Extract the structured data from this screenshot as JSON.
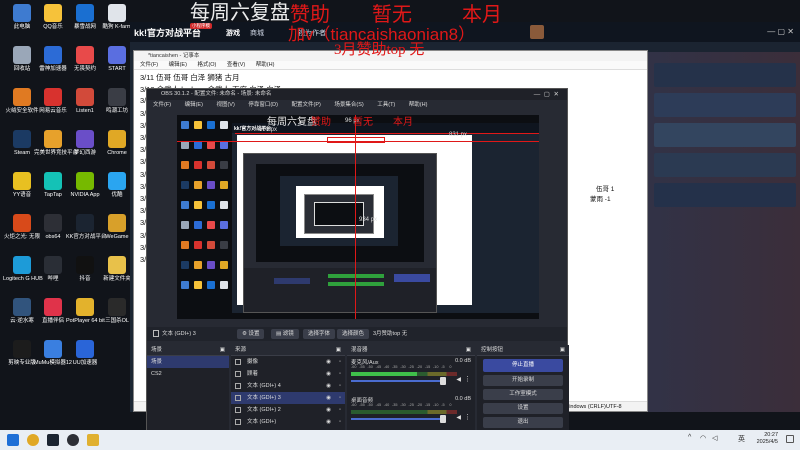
{
  "desktop": {
    "icons": [
      {
        "label": "此电脑",
        "color": "#3e7bd0",
        "icon": "computer-icon"
      },
      {
        "label": "QQ音乐",
        "color": "#f6c23a",
        "icon": "qq-music-icon"
      },
      {
        "label": "暴雪战网",
        "color": "#1a6fd1",
        "icon": "battlenet-icon"
      },
      {
        "label": "酷狗 K-farm",
        "color": "#e0e4ea",
        "icon": "app-icon"
      },
      {
        "label": "回收站",
        "color": "#9aa7b8",
        "icon": "recycle-bin-icon"
      },
      {
        "label": "雷神加速器",
        "color": "#2c6bd6",
        "icon": "accelerator-icon"
      },
      {
        "label": "无畏契约",
        "color": "#e84a4a",
        "icon": "valorant-icon"
      },
      {
        "label": "START",
        "color": "#5a6ee0",
        "icon": "start-icon"
      },
      {
        "label": "火绒安全软件",
        "color": "#e07a22",
        "icon": "huorong-icon"
      },
      {
        "label": "网易云音乐",
        "color": "#d8322e",
        "icon": "netease-music-icon"
      },
      {
        "label": "Listen1",
        "color": "#d24a3a",
        "icon": "listen1-icon"
      },
      {
        "label": "鸣潮工坊",
        "color": "#3a3d45",
        "icon": "app-icon"
      },
      {
        "label": "Steam",
        "color": "#1b3a63",
        "icon": "steam-icon"
      },
      {
        "label": "完美世界竞技平台",
        "color": "#e7a12b",
        "icon": "perfect-world-icon"
      },
      {
        "label": "梦幻西游",
        "color": "#6a4ec8",
        "icon": "game-icon"
      },
      {
        "label": "Chrome",
        "color": "#e0a825",
        "icon": "chrome-icon"
      },
      {
        "label": "YY语音",
        "color": "#e8c021",
        "icon": "yy-icon"
      },
      {
        "label": "TapTap",
        "color": "#14c2b6",
        "icon": "taptap-icon"
      },
      {
        "label": "NVIDIA App",
        "color": "#76b900",
        "icon": "nvidia-icon"
      },
      {
        "label": "优酷",
        "color": "#2aa5f0",
        "icon": "youku-icon"
      },
      {
        "label": "火炬之光: 无限",
        "color": "#d84a1a",
        "icon": "game-icon"
      },
      {
        "label": "obs64",
        "color": "#2d2f36",
        "icon": "obs-icon"
      },
      {
        "label": "KK官方对战平台",
        "color": "#1b2431",
        "icon": "kk-icon"
      },
      {
        "label": "WeGame",
        "color": "#d8a02a",
        "icon": "wegame-icon"
      },
      {
        "label": "Logitech G HUB",
        "color": "#1d9bd8",
        "icon": "logitech-icon"
      },
      {
        "label": "哔哩",
        "color": "#2a2e36",
        "icon": "app-icon"
      },
      {
        "label": "抖音",
        "color": "#111111",
        "icon": "douyin-icon"
      },
      {
        "label": "新建文件夹",
        "color": "#e8c14a",
        "icon": "folder-icon"
      },
      {
        "label": "云·逆水寒",
        "color": "#31547d",
        "icon": "game-icon"
      },
      {
        "label": "直播伴侣",
        "color": "#e0334a",
        "icon": "live-companion-icon"
      },
      {
        "label": "PotPlayer 64 bit",
        "color": "#e3b22c",
        "icon": "potplayer-icon"
      },
      {
        "label": "三国杀OL",
        "color": "#2a2a2a",
        "icon": "sanguosha-icon"
      },
      {
        "label": "剪映专业版",
        "color": "#1c1c1c",
        "icon": "capcut-icon"
      },
      {
        "label": "MuMu模拟器12",
        "color": "#3a7fe0",
        "icon": "mumu-icon"
      },
      {
        "label": "UU加速器",
        "color": "#2a65d8",
        "icon": "uu-icon"
      }
    ]
  },
  "overlay": {
    "line1": "每周六复盘",
    "sponsor": "赞助",
    "none": "暂无",
    "month": "本月",
    "wechat": "加v（tiancaishaonian8）",
    "top": "3月赞助top 无"
  },
  "kk": {
    "logo": "kk!官方对战平台",
    "badge": "小程序模",
    "nav": [
      "游戏",
      "商城",
      "",
      "视为作者"
    ]
  },
  "notepad": {
    "title": "*tiancaishen - 记事本",
    "menu": [
      "文件(F)",
      "编辑(E)",
      "格式(O)",
      "查看(V)",
      "帮助(H)"
    ],
    "lines": [
      "3/11  伍哥  伍哥  白泽  狮猪  古月",
      "3/12  余武人  lookme  余武人  百度  白泽  白泽",
      "3/",
      "3/",
      "3/",
      "3/",
      "3/",
      "3/",
      "3/",
      "3/",
      "3/",
      "3/",
      "3/",
      "3/",
      "3/",
      "3/"
    ],
    "right_lines": [
      "伍哥 1",
      "蒙雨 -1"
    ],
    "status": {
      "eol": "Windows (CRLF)",
      "enc": "UTF-8"
    }
  },
  "obs": {
    "title": "OBS 30.1.2 - 配置文件: 未命名 - 场景: 未命名",
    "menu": [
      "文件(F)",
      "编辑(E)",
      "视图(V)",
      "停靠窗口(D)",
      "配置文件(P)",
      "场景集合(S)",
      "工具(T)",
      "帮助(H)"
    ],
    "preview": {
      "w1": "600 px",
      "w2": "96 px",
      "w3": "831 px",
      "w4": "934 px",
      "overlay1": "每周六复盘",
      "overlay2": "赞助",
      "overlay3": "暂无",
      "overlay4": "本月"
    },
    "srcbar": {
      "selected": "文本 (GDI+) 3",
      "settings": "设置",
      "filters": "滤镜",
      "font": "选择字体",
      "color": "选择颜色",
      "text": "3月赞助top 无"
    },
    "scenes": {
      "title": "场景",
      "items": [
        "场景",
        "CS2"
      ],
      "selected": 0
    },
    "sources": {
      "title": "来源",
      "items": [
        "摄像",
        "顾着",
        "文本 (GDI+) 4",
        "文本 (GDI+) 3",
        "文本 (GDI+) 2",
        "文本 (GDI+)"
      ],
      "selected": 3
    },
    "mixer": {
      "title": "混音器",
      "channels": [
        {
          "name": "麦克风/Aux",
          "db": "0.0 dB",
          "level": 0.62
        },
        {
          "name": "桌面音频",
          "db": "0.0 dB",
          "level": 0.0
        }
      ],
      "ticks": [
        "-60",
        "-55",
        "-50",
        "-45",
        "-40",
        "-35",
        "-30",
        "-25",
        "-20",
        "-15",
        "-10",
        "-5",
        "0"
      ]
    },
    "controls": {
      "title": "控制按钮",
      "stop_stream": "停止直播",
      "start_record": "开始录制",
      "studio": "工作室模式",
      "settings": "设置",
      "exit": "退出"
    }
  },
  "taskbar": {
    "time": "20:27",
    "date": "2025/4/5",
    "ime": "英"
  }
}
